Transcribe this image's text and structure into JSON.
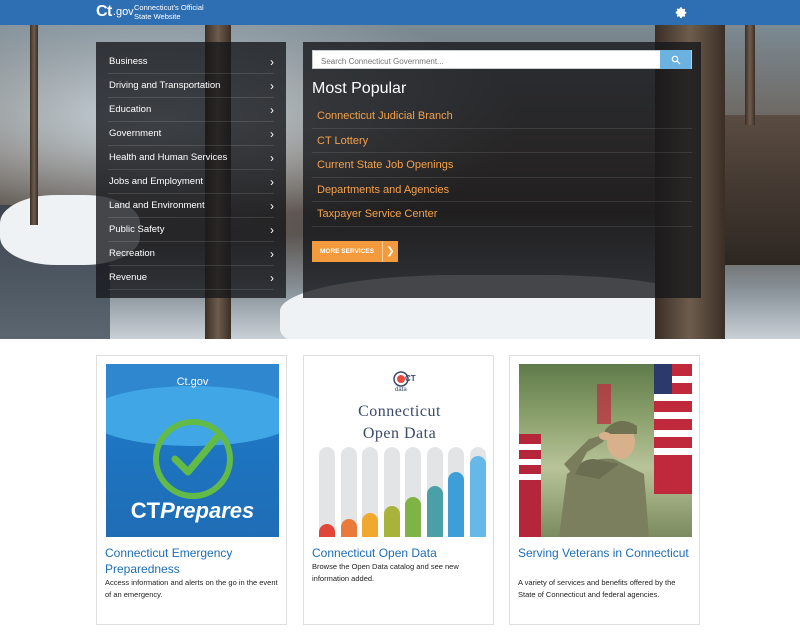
{
  "header": {
    "logo_mark": "Ct",
    "logo_gov": ".gov",
    "site_line1": "Connecticut's Official",
    "site_line2": "State Website",
    "settings_icon": "gear-icon"
  },
  "categories": [
    {
      "label": "Business"
    },
    {
      "label": "Driving and Transportation"
    },
    {
      "label": "Education"
    },
    {
      "label": "Government"
    },
    {
      "label": "Health and Human Services"
    },
    {
      "label": "Jobs and Employment"
    },
    {
      "label": "Land and Environment"
    },
    {
      "label": "Public Safety"
    },
    {
      "label": "Recreation"
    },
    {
      "label": "Revenue"
    }
  ],
  "search": {
    "placeholder": "Search Connecticut Government...",
    "icon": "search-icon"
  },
  "popular": {
    "heading": "Most Popular",
    "links": [
      {
        "label": "Connecticut Judicial Branch"
      },
      {
        "label": "CT Lottery"
      },
      {
        "label": "Current State Job Openings"
      },
      {
        "label": "Departments and Agencies"
      },
      {
        "label": "Taxpayer Service Center"
      }
    ],
    "more_button": "MORE SERVICES"
  },
  "cards": [
    {
      "title": "Connecticut Emergency Preparedness",
      "desc": "Access information and alerts on the go in the event of an emergency.",
      "image": {
        "logo_mark": "Ct",
        "logo_gov": ".gov",
        "caption_prefix": "CT",
        "caption_italic": "Prepares"
      }
    },
    {
      "title": "Connecticut Open Data",
      "desc": "Browse the Open Data catalog and see new information added.",
      "image": {
        "logo_text": "CT",
        "logo_sub": "data",
        "heading_line1": "Connecticut",
        "heading_line2": "Open Data"
      }
    },
    {
      "title": "Serving Veterans in Connecticut",
      "desc": "A variety of services and benefits offered by the State of Connecticut and federal agencies."
    }
  ],
  "colors": {
    "header_blue": "#2e6fb3",
    "link_orange": "#f5a14a",
    "button_orange": "#f39a3c",
    "card_title_blue": "#1d6db6"
  }
}
